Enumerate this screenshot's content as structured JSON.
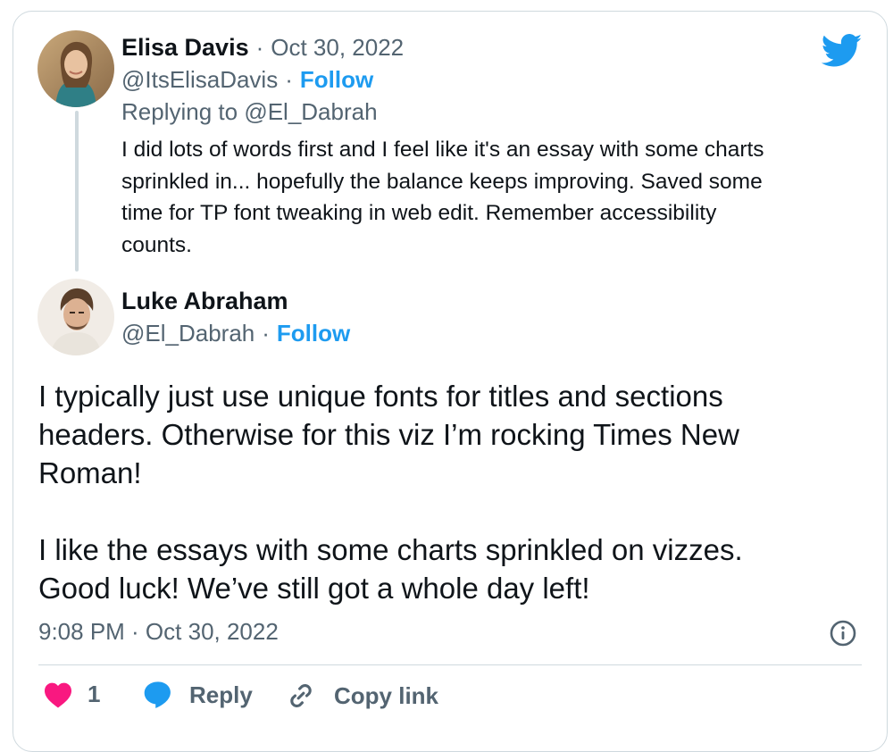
{
  "reply_tweet": {
    "author_name": "Elisa Davis",
    "date": "Oct 30, 2022",
    "handle": "@ItsElisaDavis",
    "follow_label": "Follow",
    "replying_to_prefix": "Replying to",
    "replying_to_handle": "@El_Dabrah",
    "text": "I did lots of words first and I feel like it's an essay with some charts\nsprinkled in... hopefully the balance keeps improving. Saved some\ntime for TP font tweaking in web edit. Remember accessibility\ncounts."
  },
  "main_tweet": {
    "author_name": "Luke Abraham",
    "handle": "@El_Dabrah",
    "follow_label": "Follow",
    "text": "I typically just use unique fonts for titles and sections\nheaders. Otherwise for this viz I’m rocking Times New\nRoman!\n\nI like the essays with some charts sprinkled on vizzes.\nGood luck! We’ve still got a whole day left!",
    "timestamp": "9:08 PM · Oct 30, 2022"
  },
  "actions": {
    "like_count": "1",
    "reply_label": "Reply",
    "copy_link_label": "Copy link"
  },
  "separator": "·",
  "colors": {
    "brand_blue": "#1d9bf0",
    "like_red": "#f91880",
    "text_primary": "#0f1419",
    "text_secondary": "#536471",
    "border": "#cfd9de"
  },
  "icons": [
    "twitter-bird-icon",
    "info-icon",
    "heart-icon",
    "reply-bubble-icon",
    "link-icon"
  ]
}
